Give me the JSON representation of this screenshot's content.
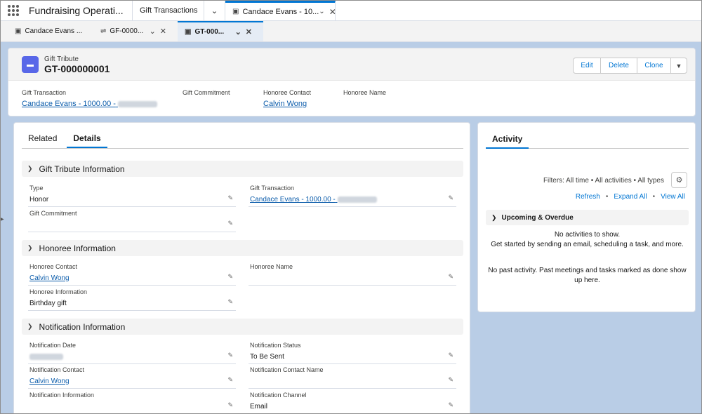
{
  "app": {
    "name": "Fundraising Operati..."
  },
  "nav_tabs": [
    {
      "label": "Gift Transactions"
    },
    {
      "label": "Candace Evans - 10..."
    }
  ],
  "sub_tabs": [
    {
      "label": "Candace Evans ..."
    },
    {
      "label": "GF-0000..."
    },
    {
      "label": "GT-000..."
    }
  ],
  "record": {
    "object_type": "Gift Tribute",
    "name": "GT-000000001",
    "actions": {
      "edit": "Edit",
      "delete": "Delete",
      "clone": "Clone"
    }
  },
  "highlights": [
    {
      "label": "Gift Transaction",
      "value": "Candace Evans - 1000.00 -"
    },
    {
      "label": "Gift Commitment",
      "value": ""
    },
    {
      "label": "Honoree Contact",
      "value": "Calvin Wong"
    },
    {
      "label": "Honoree Name",
      "value": ""
    }
  ],
  "tabs": {
    "related": "Related",
    "details": "Details"
  },
  "sections": {
    "gift_tribute": {
      "title": "Gift Tribute Information",
      "type_label": "Type",
      "type_value": "Honor",
      "gift_transaction_label": "Gift Transaction",
      "gift_transaction_value": "Candace Evans - 1000.00 -",
      "gift_commitment_label": "Gift Commitment",
      "gift_commitment_value": ""
    },
    "honoree": {
      "title": "Honoree Information",
      "contact_label": "Honoree Contact",
      "contact_value": "Calvin Wong",
      "name_label": "Honoree Name",
      "name_value": "",
      "info_label": "Honoree Information",
      "info_value": "Birthday gift"
    },
    "notification": {
      "title": "Notification Information",
      "date_label": "Notification Date",
      "status_label": "Notification Status",
      "status_value": "To Be Sent",
      "contact_label": "Notification Contact",
      "contact_value": "Calvin Wong",
      "contact_name_label": "Notification Contact Name",
      "contact_name_value": "",
      "info_label": "Notification Information",
      "info_value": "",
      "channel_label": "Notification Channel",
      "channel_value": "Email"
    }
  },
  "activity": {
    "tab": "Activity",
    "filters": "Filters: All time • All activities • All types",
    "links": {
      "refresh": "Refresh",
      "expand": "Expand All",
      "view": "View All"
    },
    "upcoming_title": "Upcoming & Overdue",
    "no_activities": "No activities to show.",
    "get_started": "Get started by sending an email, scheduling a task, and more.",
    "no_past": "No past activity. Past meetings and tasks marked as done show up here."
  },
  "colors": {
    "brand": "#0176d3",
    "link": "#0b5cab",
    "object_icon": "#5867e8",
    "background": "#b9cde6"
  }
}
